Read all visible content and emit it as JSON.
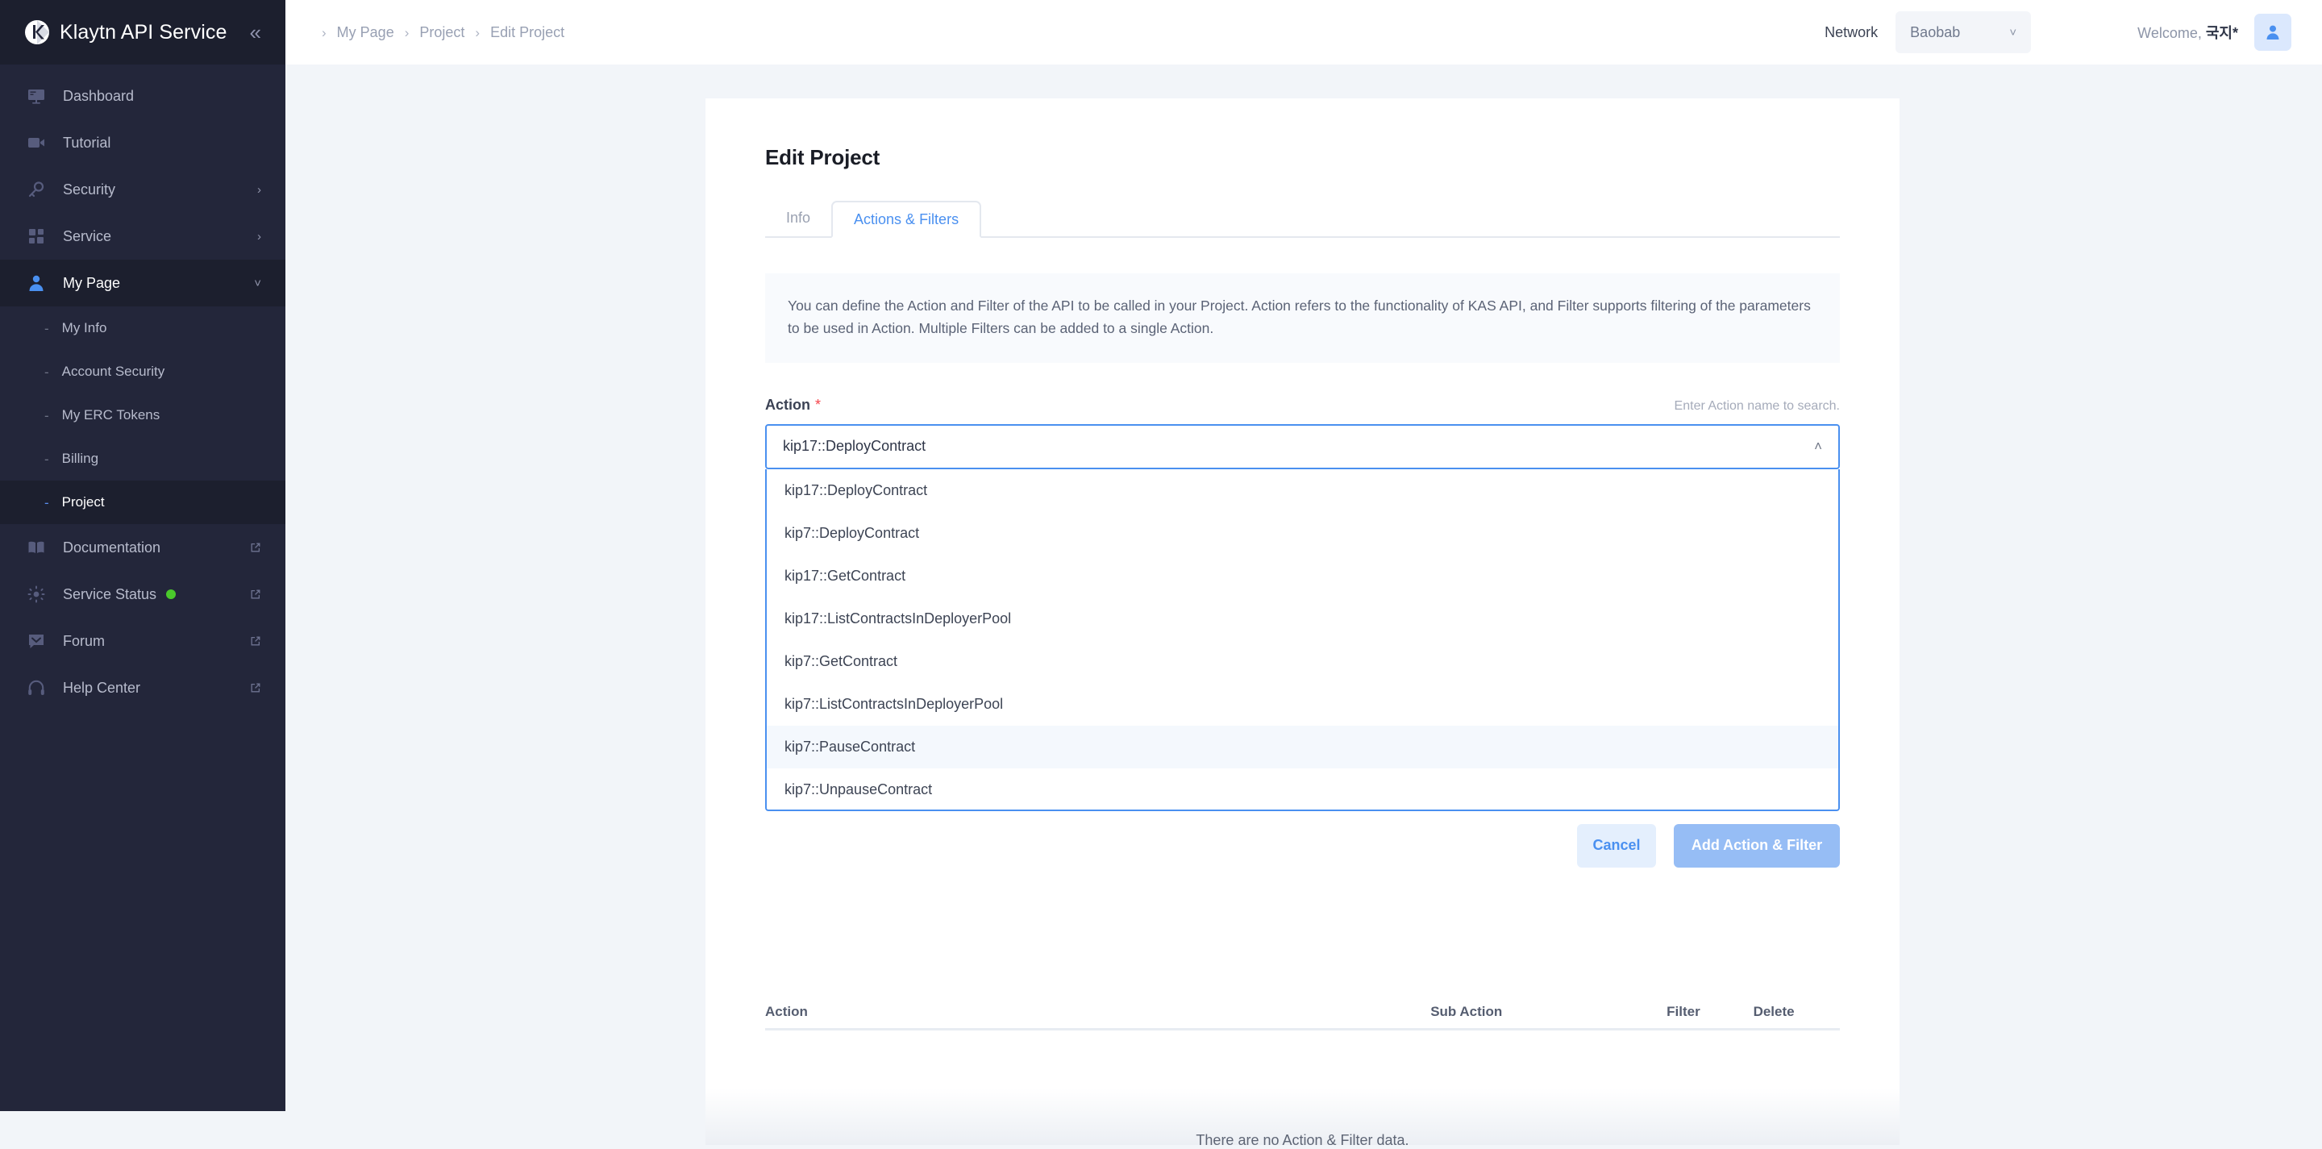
{
  "brand": {
    "name": "Klaytn API Service",
    "logo_icon": "klaytn-logo-icon",
    "collapse_icon": "chevron-double-left-icon"
  },
  "sidebar": {
    "items": [
      {
        "label": "Dashboard",
        "icon": "monitor-icon",
        "type": "item"
      },
      {
        "label": "Tutorial",
        "icon": "video-camera-icon",
        "type": "item"
      },
      {
        "label": "Security",
        "icon": "key-icon",
        "type": "expandable",
        "chevron": "chevron-right-icon"
      },
      {
        "label": "Service",
        "icon": "grid-icon",
        "type": "expandable",
        "chevron": "chevron-right-icon"
      },
      {
        "label": "My Page",
        "icon": "user-icon",
        "type": "expandable",
        "chevron": "chevron-down-icon",
        "active": true
      }
    ],
    "sub_items": [
      {
        "label": "My Info",
        "dash": "-"
      },
      {
        "label": "Account Security",
        "dash": "-"
      },
      {
        "label": "My ERC Tokens",
        "dash": "-"
      },
      {
        "label": "Billing",
        "dash": "-"
      },
      {
        "label": "Project",
        "dash": "-",
        "active": true
      }
    ],
    "external_items": [
      {
        "label": "Documentation",
        "icon": "book-icon",
        "external_icon": "external-link-icon"
      },
      {
        "label": "Service Status",
        "icon": "sun-icon",
        "external_icon": "external-link-icon",
        "status_dot": "#4ac92b"
      },
      {
        "label": "Forum",
        "icon": "chat-icon",
        "external_icon": "external-link-icon"
      },
      {
        "label": "Help Center",
        "icon": "headset-icon",
        "external_icon": "external-link-icon"
      }
    ]
  },
  "topbar": {
    "breadcrumb": [
      "My Page",
      "Project",
      "Edit Project"
    ],
    "breadcrumb_separator": "›",
    "network_label": "Network",
    "network_value": "Baobab",
    "network_caret": "chevron-down-icon",
    "welcome_prefix": "Welcome, ",
    "welcome_user": "국지*",
    "avatar_icon": "user-avatar-icon"
  },
  "main": {
    "title": "Edit Project",
    "tabs": [
      {
        "label": "Info",
        "active": false
      },
      {
        "label": "Actions & Filters",
        "active": true
      }
    ],
    "info_text": "You can define the Action and Filter of the API to be called in your Project. Action refers to the functionality of KAS API, and Filter supports filtering of the parameters to be used in Action. Multiple Filters can be added to a single Action.",
    "action_field": {
      "label": "Action",
      "required_marker": "*",
      "hint": "Enter Action name to search.",
      "value": "kip17::DeployContract",
      "caret_icon": "chevron-up-icon",
      "options": [
        {
          "label": "kip17::DeployContract",
          "highlight": false
        },
        {
          "label": "kip7::DeployContract",
          "highlight": false
        },
        {
          "label": "kip17::GetContract",
          "highlight": false
        },
        {
          "label": "kip17::ListContractsInDeployerPool",
          "highlight": false
        },
        {
          "label": "kip7::GetContract",
          "highlight": false
        },
        {
          "label": "kip7::ListContractsInDeployerPool",
          "highlight": false
        },
        {
          "label": "kip7::PauseContract",
          "highlight": true
        },
        {
          "label": "kip7::UnpauseContract",
          "highlight": false
        }
      ]
    },
    "buttons": {
      "cancel": "Cancel",
      "submit": "Add Action & Filter"
    },
    "table": {
      "columns": [
        "Action",
        "Sub Action",
        "Filter",
        "Delete"
      ],
      "empty_message": "There are no Action & Filter data."
    }
  },
  "colors": {
    "accent": "#4a90f0",
    "sidebar_bg": "#23263a",
    "page_bg": "#f2f5f9",
    "required": "#f5434a",
    "status_green": "#4ac92b"
  }
}
